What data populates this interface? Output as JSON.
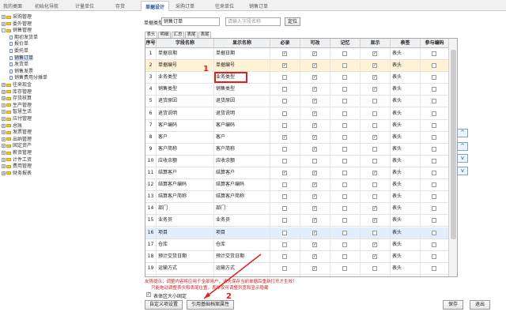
{
  "top_tabs": [
    "我的桌面",
    "初始化导航",
    "计量单位",
    "存货",
    "单据设计",
    "采购订单",
    "往来单位",
    "销售订单"
  ],
  "active_tab_index": 4,
  "tree": [
    {
      "label": "采购管理",
      "level": 0,
      "toggle": "+",
      "icon": "folder"
    },
    {
      "label": "委外管理",
      "level": 0,
      "toggle": "+",
      "icon": "folder"
    },
    {
      "label": "销售管理",
      "level": 0,
      "toggle": "-",
      "icon": "folder"
    },
    {
      "label": "期初发货单",
      "level": 1,
      "icon": "doc"
    },
    {
      "label": "报价单",
      "level": 1,
      "icon": "doc"
    },
    {
      "label": "委托单",
      "level": 1,
      "icon": "doc"
    },
    {
      "label": "销售订单",
      "level": 1,
      "icon": "doc",
      "selected": true
    },
    {
      "label": "发货单",
      "level": 1,
      "icon": "doc"
    },
    {
      "label": "销售发票",
      "level": 1,
      "icon": "doc"
    },
    {
      "label": "销售费用分摊单",
      "level": 1,
      "icon": "doc"
    },
    {
      "label": "往来现金",
      "level": 0,
      "toggle": "+",
      "icon": "folder"
    },
    {
      "label": "库存管理",
      "level": 0,
      "toggle": "+",
      "icon": "folder"
    },
    {
      "label": "存货核算",
      "level": 0,
      "toggle": "+",
      "icon": "folder"
    },
    {
      "label": "生产管理",
      "level": 0,
      "toggle": "+",
      "icon": "folder"
    },
    {
      "label": "智慧生活",
      "level": 0,
      "toggle": "+",
      "icon": "folder"
    },
    {
      "label": "应付管理",
      "level": 0,
      "toggle": "+",
      "icon": "folder"
    },
    {
      "label": "总账",
      "level": 0,
      "toggle": "+",
      "icon": "folder"
    },
    {
      "label": "发票管理",
      "level": 0,
      "toggle": "+",
      "icon": "folder"
    },
    {
      "label": "出纳管理",
      "level": 0,
      "toggle": "+",
      "icon": "folder"
    },
    {
      "label": "固定资产",
      "level": 0,
      "toggle": "+",
      "icon": "folder"
    },
    {
      "label": "薪资管理",
      "level": 0,
      "toggle": "+",
      "icon": "folder"
    },
    {
      "label": "计件工资",
      "level": 0,
      "toggle": "+",
      "icon": "folder"
    },
    {
      "label": "费用管理",
      "level": 0,
      "toggle": "+",
      "icon": "folder"
    },
    {
      "label": "财务报表",
      "level": 0,
      "toggle": "+",
      "icon": "folder"
    }
  ],
  "search": {
    "label": "单据类型",
    "value": "销售订单",
    "placeholder": "请输入字段名称",
    "button": "定位"
  },
  "sub_tabs": [
    "表头",
    "明细",
    "汇总",
    "表尾",
    "表尾"
  ],
  "active_sub_tab": 0,
  "columns": [
    "序号",
    "字段名称",
    "显示名称",
    "必录",
    "可改",
    "记忆",
    "显示",
    "表签",
    "参与编码"
  ],
  "rows": [
    {
      "no": "1",
      "field": "单据日期",
      "display": "单据日期",
      "req": true,
      "edit": true,
      "mem": false,
      "show": true,
      "tag": "表头",
      "code": false,
      "style": ""
    },
    {
      "no": "2",
      "field": "单据编号",
      "display": "单据编号",
      "req": true,
      "edit": true,
      "mem": false,
      "show": true,
      "tag": "表头",
      "code": false,
      "style": "hl"
    },
    {
      "no": "3",
      "field": "业务类型",
      "display": "业务类型",
      "req": false,
      "edit": true,
      "mem": false,
      "show": true,
      "tag": "表头",
      "code": false,
      "style": ""
    },
    {
      "no": "4",
      "field": "销售类型",
      "display": "销售类型",
      "req": false,
      "edit": true,
      "mem": false,
      "show": true,
      "tag": "表头",
      "code": false,
      "style": ""
    },
    {
      "no": "5",
      "field": "退货原因",
      "display": "退货原因",
      "req": false,
      "edit": true,
      "mem": false,
      "show": false,
      "tag": "表头",
      "code": false,
      "style": ""
    },
    {
      "no": "6",
      "field": "退货说明",
      "display": "退货说明",
      "req": false,
      "edit": true,
      "mem": false,
      "show": false,
      "tag": "表头",
      "code": false,
      "style": ""
    },
    {
      "no": "7",
      "field": "客户编码",
      "display": "客户编码",
      "req": false,
      "edit": true,
      "mem": false,
      "show": false,
      "tag": "表头",
      "code": false,
      "style": ""
    },
    {
      "no": "8",
      "field": "客户",
      "display": "客户",
      "req": true,
      "edit": true,
      "mem": false,
      "show": true,
      "tag": "表头",
      "code": false,
      "style": ""
    },
    {
      "no": "9",
      "field": "客户简称",
      "display": "客户简称",
      "req": false,
      "edit": true,
      "mem": false,
      "show": false,
      "tag": "表头",
      "code": false,
      "style": ""
    },
    {
      "no": "10",
      "field": "应收余额",
      "display": "应收余额",
      "req": false,
      "edit": false,
      "mem": false,
      "show": false,
      "tag": "表头",
      "code": false,
      "style": ""
    },
    {
      "no": "11",
      "field": "结算客户",
      "display": "结算客户",
      "req": true,
      "edit": true,
      "mem": false,
      "show": true,
      "tag": "表头",
      "code": false,
      "style": ""
    },
    {
      "no": "12",
      "field": "结算客户编码",
      "display": "结算客户编码",
      "req": false,
      "edit": true,
      "mem": false,
      "show": false,
      "tag": "表头",
      "code": false,
      "style": ""
    },
    {
      "no": "13",
      "field": "结算客户简称",
      "display": "结算客户简称",
      "req": false,
      "edit": true,
      "mem": false,
      "show": false,
      "tag": "表头",
      "code": false,
      "style": ""
    },
    {
      "no": "14",
      "field": "部门",
      "display": "部门",
      "req": false,
      "edit": true,
      "mem": false,
      "show": true,
      "tag": "表头",
      "code": false,
      "style": ""
    },
    {
      "no": "15",
      "field": "业务员",
      "display": "业务员",
      "req": false,
      "edit": true,
      "mem": false,
      "show": true,
      "tag": "表头",
      "code": false,
      "style": ""
    },
    {
      "no": "16",
      "field": "项目",
      "display": "项目",
      "req": false,
      "edit": true,
      "mem": false,
      "show": false,
      "tag": "表头",
      "code": false,
      "style": "blue"
    },
    {
      "no": "17",
      "field": "仓库",
      "display": "仓库",
      "req": false,
      "edit": true,
      "mem": false,
      "show": true,
      "tag": "表头",
      "code": false,
      "style": ""
    },
    {
      "no": "18",
      "field": "预计交货日期",
      "display": "预计交货日期",
      "req": false,
      "edit": true,
      "mem": false,
      "show": true,
      "tag": "表头",
      "code": false,
      "style": ""
    },
    {
      "no": "19",
      "field": "运输方式",
      "display": "运输方式",
      "req": false,
      "edit": true,
      "mem": false,
      "show": false,
      "tag": "表头",
      "code": false,
      "style": ""
    },
    {
      "no": "20",
      "field": "结算方式",
      "display": "结算方式",
      "req": false,
      "edit": true,
      "mem": false,
      "show": false,
      "tag": "表头",
      "code": false,
      "style": ""
    }
  ],
  "annotations": {
    "one": "1",
    "two": "2"
  },
  "hints": {
    "line1": "友情提示：调整内容将应用于全部用户，请先保存当前单据后重新打开才生效！",
    "line2": "只能拖动调整表头和表尾位置，表体仅可调整列宽和显示隐藏"
  },
  "checkbox_label": "表体区大小固定",
  "buttons": {
    "custom": "自定义项设置",
    "reference": "引用基础档案属性",
    "save": "保存",
    "exit": "退出"
  },
  "arrows": [
    "^",
    "^",
    "v",
    "v"
  ]
}
